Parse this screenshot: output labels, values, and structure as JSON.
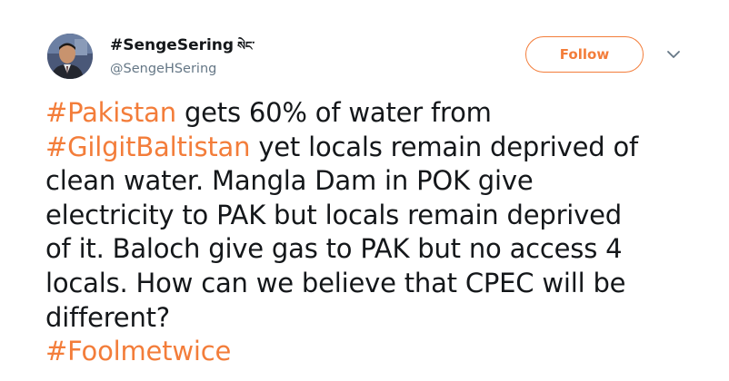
{
  "colors": {
    "accent": "#f37d3a",
    "text": "#14171a",
    "secondary": "#657786"
  },
  "author": {
    "display_name": "#SengeSering",
    "name_suffix": "སེང་",
    "handle": "@SengeHSering",
    "avatar_icon": "profile-photo"
  },
  "follow_button": {
    "label": "Follow"
  },
  "menu": {
    "icon": "chevron-down-icon"
  },
  "tweet": {
    "lines": [
      [
        {
          "text": "#Pakistan",
          "hashtag": true
        },
        {
          "text": " gets 60% of water from",
          "hashtag": false
        }
      ],
      [
        {
          "text": "#GilgitBaltistan",
          "hashtag": true
        },
        {
          "text": " yet locals remain deprived of",
          "hashtag": false
        }
      ],
      [
        {
          "text": "clean water. Mangla Dam in POK give",
          "hashtag": false
        }
      ],
      [
        {
          "text": "electricity to PAK but locals remain deprived",
          "hashtag": false
        }
      ],
      [
        {
          "text": "of it. Baloch give gas to PAK but no access 4",
          "hashtag": false
        }
      ],
      [
        {
          "text": "locals. How can we believe that CPEC will be",
          "hashtag": false
        }
      ],
      [
        {
          "text": "different?",
          "hashtag": false
        }
      ],
      [
        {
          "text": "#Foolmetwice",
          "hashtag": true
        }
      ]
    ]
  }
}
